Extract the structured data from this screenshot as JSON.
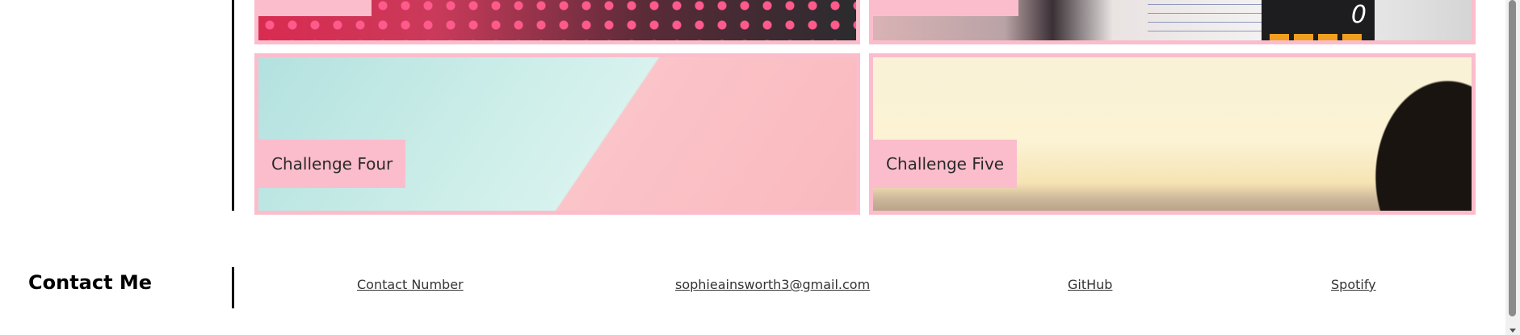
{
  "challenges": {
    "cards": [
      {
        "label": "Challenge Four"
      },
      {
        "label": "Challenge Five"
      }
    ]
  },
  "footer": {
    "title": "Contact Me",
    "links": {
      "phone": "Contact Number",
      "email": "sophieainsworth3@gmail.com",
      "github": "GitHub",
      "spotify": "Spotify"
    }
  },
  "images": {
    "calculator_display": "0"
  },
  "colors": {
    "accent_pink": "#fbbdcc",
    "rule_black": "#000000"
  }
}
